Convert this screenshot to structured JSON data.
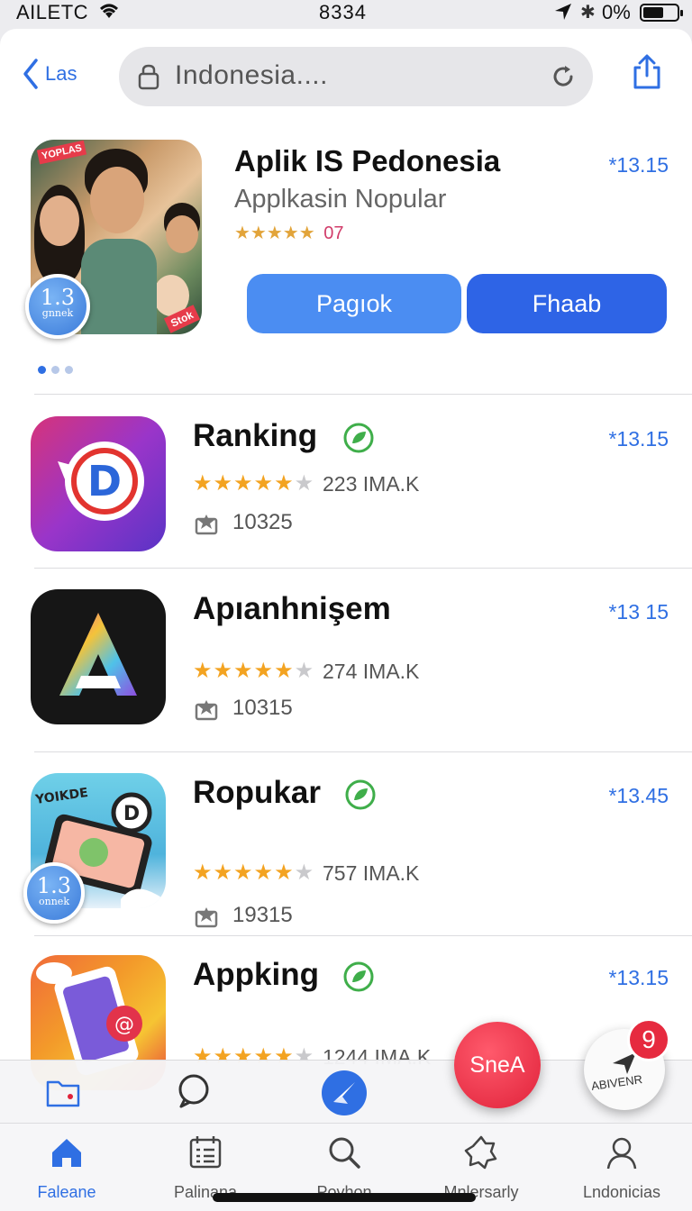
{
  "status_bar": {
    "carrier": "AILETC",
    "time": "8334",
    "battery": "0%"
  },
  "nav": {
    "back_label": "Las",
    "search_text": "Indonesia...."
  },
  "featured": {
    "title": "Aplik IS Pedonesia",
    "subtitle": "Applkasin Nopular",
    "stars": "★★★★★",
    "rating_count": "07",
    "price": "*13.15",
    "button_primary": "Pagıok",
    "button_secondary": "Fhaab",
    "tag_top": "YOPLAS",
    "tag_bottom": "Stok",
    "badge_num": "1.3",
    "badge_sub": "gnnek"
  },
  "apps": [
    {
      "name": "Ranking",
      "price": "*13.15",
      "stars_filled": "★★★★★",
      "stars_empty": "★",
      "rating_count": "223 IMA.K",
      "downloads": "10325",
      "verified": true,
      "icon": "d-speech-bubble-icon"
    },
    {
      "name": "Apıanhnişem",
      "price": "*13 15",
      "stars_filled": "★★★★★",
      "stars_empty": "★",
      "rating_count": "274 IMA.K",
      "downloads": "10315",
      "verified": false,
      "icon": "colorful-a-icon"
    },
    {
      "name": "Ropukar",
      "price": "*13.45",
      "stars_filled": "★★★★★",
      "stars_empty": "★",
      "rating_count": "757 IMA.K",
      "downloads": "19315",
      "verified": true,
      "icon": "phone-food-icon",
      "icon_label": "YOIKDE",
      "badge_num": "1.3",
      "badge_sub": "onnek"
    },
    {
      "name": "Appking",
      "price": "*13.15",
      "stars_filled": "★★★★★",
      "stars_empty": "★",
      "rating_count": "1244 IMA.K",
      "downloads": "",
      "verified": true,
      "icon": "phone-chat-icon"
    }
  ],
  "floating": {
    "red_button": "SneA",
    "white_button": "ABIVENR",
    "notification_count": "9"
  },
  "tab_bar": [
    {
      "label": "Faleane",
      "icon": "home-icon",
      "active": true
    },
    {
      "label": "Palinana",
      "icon": "list-icon",
      "active": false
    },
    {
      "label": "Povhon",
      "icon": "search-icon",
      "active": false
    },
    {
      "label": "Mnlersarly",
      "icon": "star-badge-icon",
      "active": false
    },
    {
      "label": "Lndonicias",
      "icon": "person-icon",
      "active": false
    }
  ],
  "colors": {
    "accent": "#2f6fe3",
    "star": "#f3a321",
    "red": "#e0223a"
  }
}
